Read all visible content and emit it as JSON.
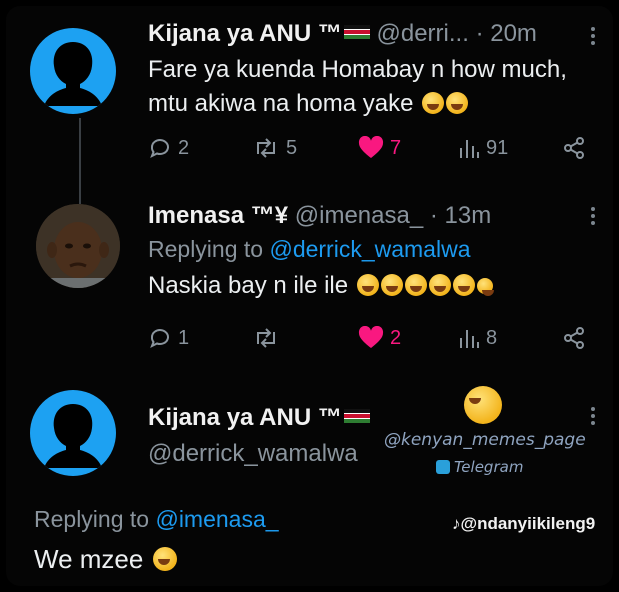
{
  "tweets": [
    {
      "name": "Kijana ya ANU ™",
      "handle": "@derri...",
      "time": "· 20m",
      "text_line1": "Fare ya kuenda Homabay n how much,",
      "text_line2": "mtu akiwa na homa yake",
      "stats": {
        "replies": "2",
        "retweets": "5",
        "likes": "7",
        "views": "91"
      },
      "avatar_icon": "default-profile-silhouette-icon",
      "flag_icon": "kenya-flag-icon"
    },
    {
      "name": "Imenasa ™¥",
      "handle": "@imenasa_",
      "time": "· 13m",
      "replying_prefix": "Replying to ",
      "replying_handle": "@derrick_wamalwa",
      "text": "Naskia bay n ile ile",
      "stats": {
        "replies": "1",
        "likes": "2",
        "views": "8"
      },
      "avatar_icon": "child-photo-avatar"
    },
    {
      "name": "Kijana ya ANU ™",
      "handle": "@derrick_wamalwa",
      "replying_prefix": "Replying to ",
      "replying_handle": "@imenasa_",
      "text": "We mzee",
      "avatar_icon": "default-profile-silhouette-icon",
      "flag_icon": "kenya-flag-icon"
    }
  ],
  "overlays": {
    "watermark_handle": "@kenyan_memes_page",
    "watermark_telegram": "Telegram",
    "tiktok_handle": "@ndanyiikileng9"
  },
  "colors": {
    "accent": "#1d9bf0",
    "like": "#f91880",
    "muted": "#8a949d",
    "background": "#000000"
  }
}
